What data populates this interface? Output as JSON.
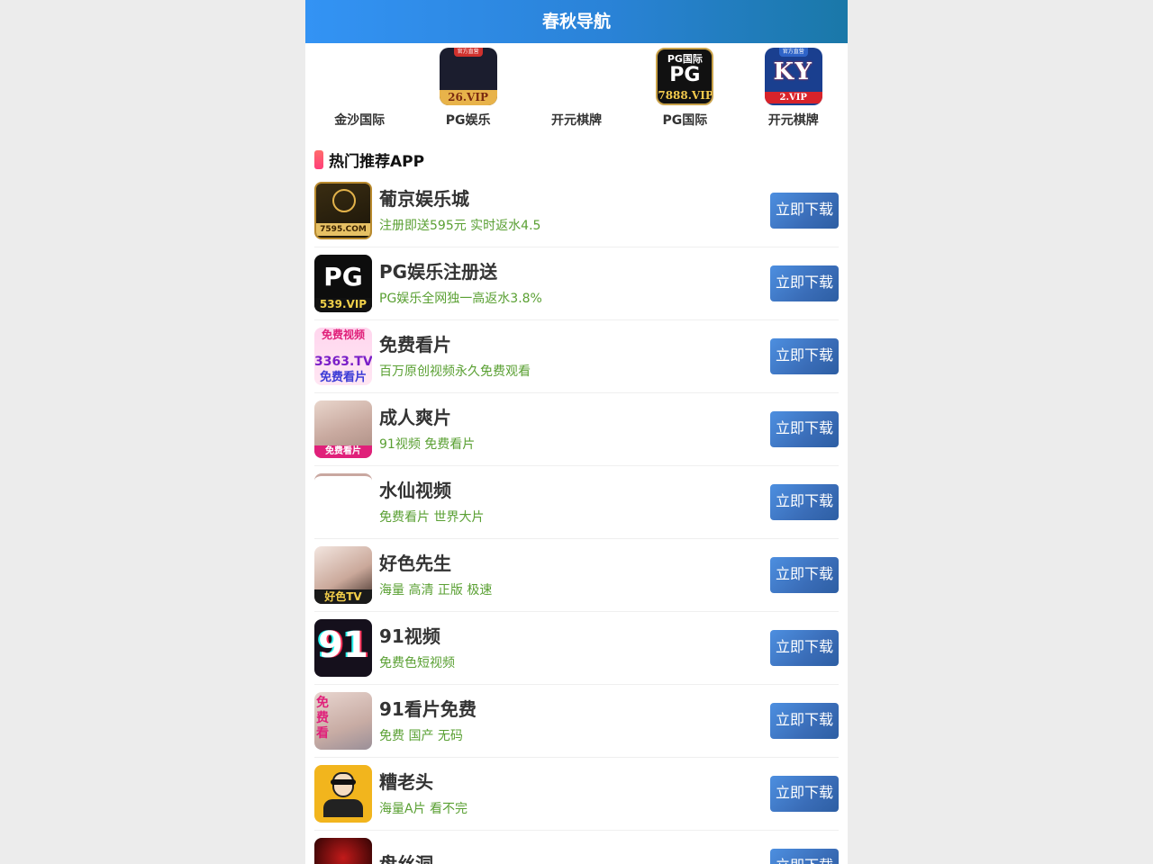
{
  "header": {
    "title": "春秋导航"
  },
  "top_apps": [
    {
      "label": "金沙国际",
      "icon": "blank-icon"
    },
    {
      "label": "PG娱乐",
      "icon": "pg-26vip-icon",
      "badge": "官方直营",
      "tag": "26.VIP"
    },
    {
      "label": "开元棋牌",
      "icon": "blank-icon"
    },
    {
      "label": "PG国际",
      "icon": "pg-intl-icon",
      "brand": "PG国际",
      "logo": "PG",
      "tag": "7888.VIP"
    },
    {
      "label": "开元棋牌",
      "icon": "ky-icon",
      "badge": "官方直营",
      "logo": "KY",
      "tag": "2.VIP"
    }
  ],
  "section": {
    "title": "热门推荐APP"
  },
  "apps": [
    {
      "name": "葡京娱乐城",
      "desc": "注册即送595元 实时返水4.5",
      "button": "立即下载",
      "icon": "pujing-icon",
      "icon_text": "7595.COM"
    },
    {
      "name": "PG娱乐注册送",
      "desc": "PG娱乐全网独一高返水3.8%",
      "button": "立即下载",
      "icon": "pg-539-icon",
      "icon_text": "539.VIP",
      "icon_logo": "PG"
    },
    {
      "name": "免费看片",
      "desc": "百万原创视频永久免费观看",
      "button": "立即下载",
      "icon": "free-video-icon",
      "icon_text": "3363.TV",
      "icon_top": "免费视频",
      "icon_bottom": "免费看片"
    },
    {
      "name": "成人爽片",
      "desc": "91视频 免费看片",
      "button": "立即下载",
      "icon": "adult-video-icon",
      "icon_text": "免费看片"
    },
    {
      "name": "水仙视频",
      "desc": "免费看片 世界大片",
      "button": "立即下载",
      "icon": "blank-icon"
    },
    {
      "name": "好色先生",
      "desc": "海量 高清 正版 极速",
      "button": "立即下载",
      "icon": "haose-tv-icon",
      "icon_text": "好色TV"
    },
    {
      "name": "91视频",
      "desc": "免费色短视频",
      "button": "立即下载",
      "icon": "91-icon",
      "icon_text": "91"
    },
    {
      "name": "91看片免费",
      "desc": "免费 国产 无码",
      "button": "立即下载",
      "icon": "91-free-icon",
      "icon_text": "免费看"
    },
    {
      "name": "糟老头",
      "desc": "海量A片 看不完",
      "button": "立即下载",
      "icon": "old-man-icon"
    },
    {
      "name": "盘丝洞",
      "desc": "",
      "button": "立即下载",
      "icon": "pansidong-icon"
    }
  ],
  "colors": {
    "header_start": "#3393f4",
    "header_end": "#1a78a8",
    "desc_green": "#5aa033",
    "button_blue": "#3a6db8"
  }
}
